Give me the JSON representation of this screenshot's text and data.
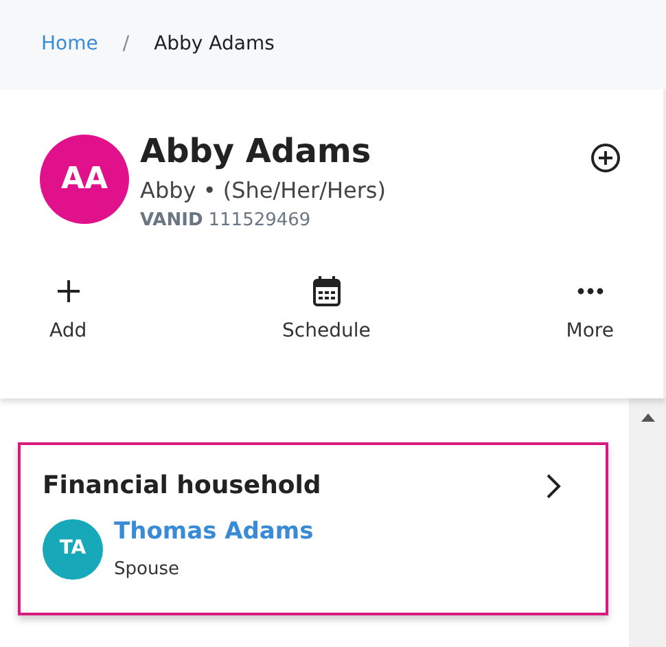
{
  "breadcrumb": [
    {
      "label": "Home",
      "kind": "link"
    },
    {
      "label": "/",
      "kind": "separator"
    },
    {
      "label": "Abby Adams",
      "kind": "current"
    }
  ],
  "profile": {
    "initials": "AA",
    "name": "Abby Adams",
    "subtitle": "Abby • (She/Her/Hers)",
    "id_label": "VANID",
    "id_value": "111529469"
  },
  "actions": [
    {
      "kind": "add",
      "label": "Add"
    },
    {
      "kind": "schedule",
      "label": "Schedule"
    },
    {
      "kind": "more",
      "label": "More"
    }
  ],
  "household": {
    "title": "Financial household",
    "members": [
      {
        "initials": "TA",
        "name": "Thomas Adams",
        "relation": "Spouse"
      }
    ]
  }
}
